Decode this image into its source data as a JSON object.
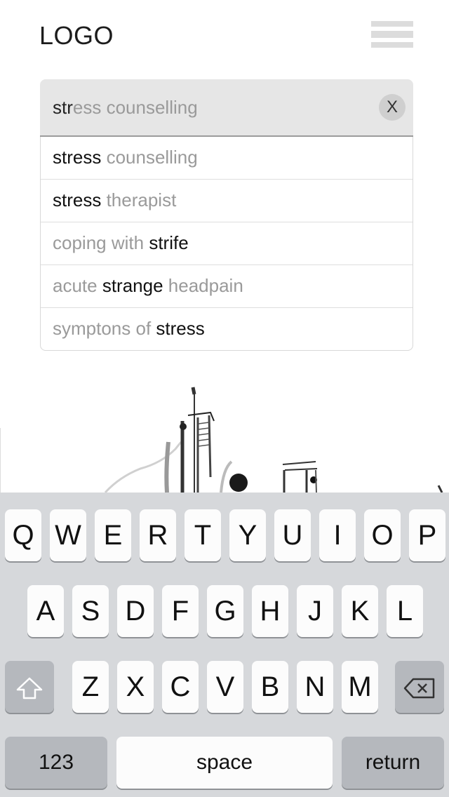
{
  "header": {
    "logo_text": "LOGO",
    "menu_icon": "hamburger-menu-icon"
  },
  "search": {
    "typed": "str",
    "suggested_completion": "ess counselling",
    "clear_label": "X"
  },
  "suggestions": [
    [
      {
        "text": "stress",
        "bold": true
      },
      {
        "text": " counselling",
        "bold": false
      }
    ],
    [
      {
        "text": "stress",
        "bold": true
      },
      {
        "text": " therapist",
        "bold": false
      }
    ],
    [
      {
        "text": "coping with ",
        "bold": false
      },
      {
        "text": "strife",
        "bold": true
      }
    ],
    [
      {
        "text": "acute ",
        "bold": false
      },
      {
        "text": "strange",
        "bold": true
      },
      {
        "text": " headpain",
        "bold": false
      }
    ],
    [
      {
        "text": "symptons of ",
        "bold": false
      },
      {
        "text": "stress",
        "bold": true
      }
    ]
  ],
  "keyboard": {
    "row1": [
      "Q",
      "W",
      "E",
      "R",
      "T",
      "Y",
      "U",
      "I",
      "O",
      "P"
    ],
    "row2": [
      "A",
      "S",
      "D",
      "F",
      "G",
      "H",
      "J",
      "K",
      "L"
    ],
    "row3": [
      "Z",
      "X",
      "C",
      "V",
      "B",
      "N",
      "M"
    ],
    "shift_icon": "shift-arrow-icon",
    "delete_icon": "backspace-icon",
    "numbers_label": "123",
    "space_label": "space",
    "return_label": "return"
  },
  "colors": {
    "keyboard_bg": "#d6d8db",
    "key_bg": "#fcfcfc",
    "function_key_bg": "#b5b8bd",
    "search_bg": "#e6e6e6",
    "suggestion_muted": "#9a9a9a"
  }
}
